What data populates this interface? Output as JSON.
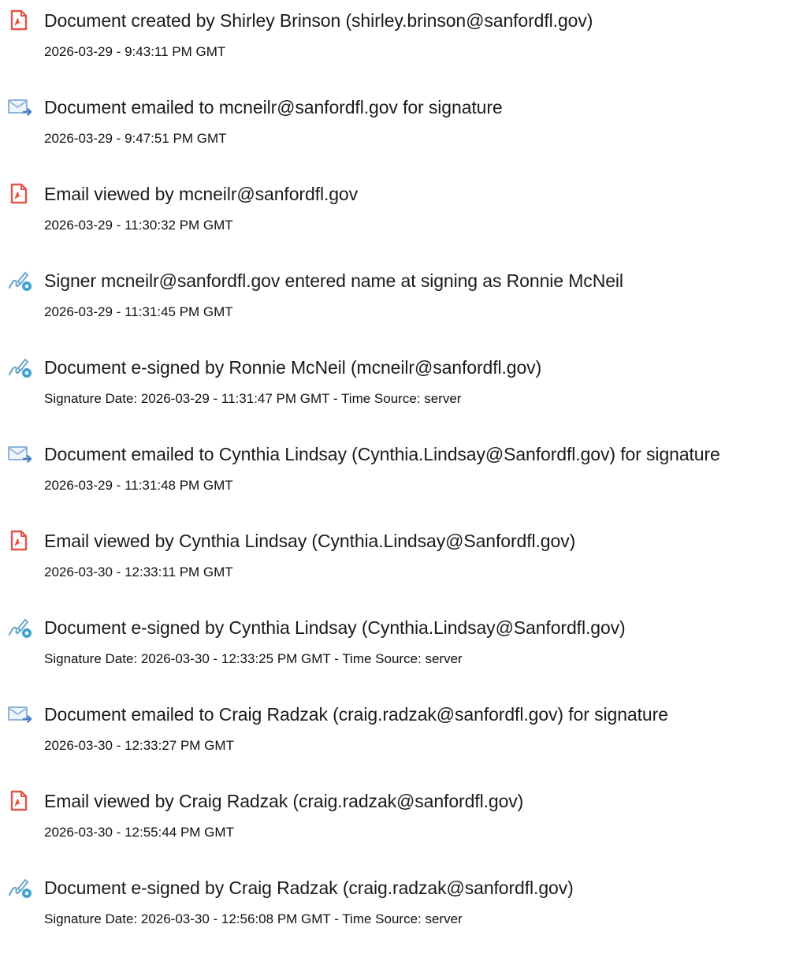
{
  "colors": {
    "pdf_icon": "#e0544b",
    "email_icon": "#7aa6d6",
    "signer_icon": "#3ba3d0"
  },
  "events": [
    {
      "icon": "pdf-document-icon",
      "title": "Document created by Shirley Brinson (shirley.brinson@sanfordfl.gov)",
      "meta": "2026-03-29 - 9:43:11 PM GMT"
    },
    {
      "icon": "email-sent-icon",
      "title": "Document emailed to mcneilr@sanfordfl.gov for signature",
      "meta": "2026-03-29 - 9:47:51 PM GMT"
    },
    {
      "icon": "pdf-document-icon",
      "title": "Email viewed by mcneilr@sanfordfl.gov",
      "meta": "2026-03-29 - 11:30:32 PM GMT"
    },
    {
      "icon": "signature-pen-icon",
      "title": "Signer mcneilr@sanfordfl.gov entered name at signing as Ronnie McNeil",
      "meta": "2026-03-29 - 11:31:45 PM GMT"
    },
    {
      "icon": "signature-pen-icon",
      "title": "Document e-signed by Ronnie McNeil (mcneilr@sanfordfl.gov)",
      "meta": "Signature Date: 2026-03-29 - 11:31:47 PM GMT - Time Source: server"
    },
    {
      "icon": "email-sent-icon",
      "title": "Document emailed to Cynthia Lindsay (Cynthia.Lindsay@Sanfordfl.gov) for signature",
      "meta": "2026-03-29 - 11:31:48 PM GMT"
    },
    {
      "icon": "pdf-document-icon",
      "title": "Email viewed by Cynthia Lindsay (Cynthia.Lindsay@Sanfordfl.gov)",
      "meta": "2026-03-30 - 12:33:11 PM GMT"
    },
    {
      "icon": "signature-pen-icon",
      "title": "Document e-signed by Cynthia Lindsay (Cynthia.Lindsay@Sanfordfl.gov)",
      "meta": "Signature Date: 2026-03-30 - 12:33:25 PM GMT - Time Source: server"
    },
    {
      "icon": "email-sent-icon",
      "title": "Document emailed to Craig Radzak (craig.radzak@sanfordfl.gov) for signature",
      "meta": "2026-03-30 - 12:33:27 PM GMT"
    },
    {
      "icon": "pdf-document-icon",
      "title": "Email viewed by Craig Radzak (craig.radzak@sanfordfl.gov)",
      "meta": "2026-03-30 - 12:55:44 PM GMT"
    },
    {
      "icon": "signature-pen-icon",
      "title": "Document e-signed by Craig Radzak (craig.radzak@sanfordfl.gov)",
      "meta": "Signature Date: 2026-03-30 - 12:56:08 PM GMT - Time Source: server"
    }
  ]
}
